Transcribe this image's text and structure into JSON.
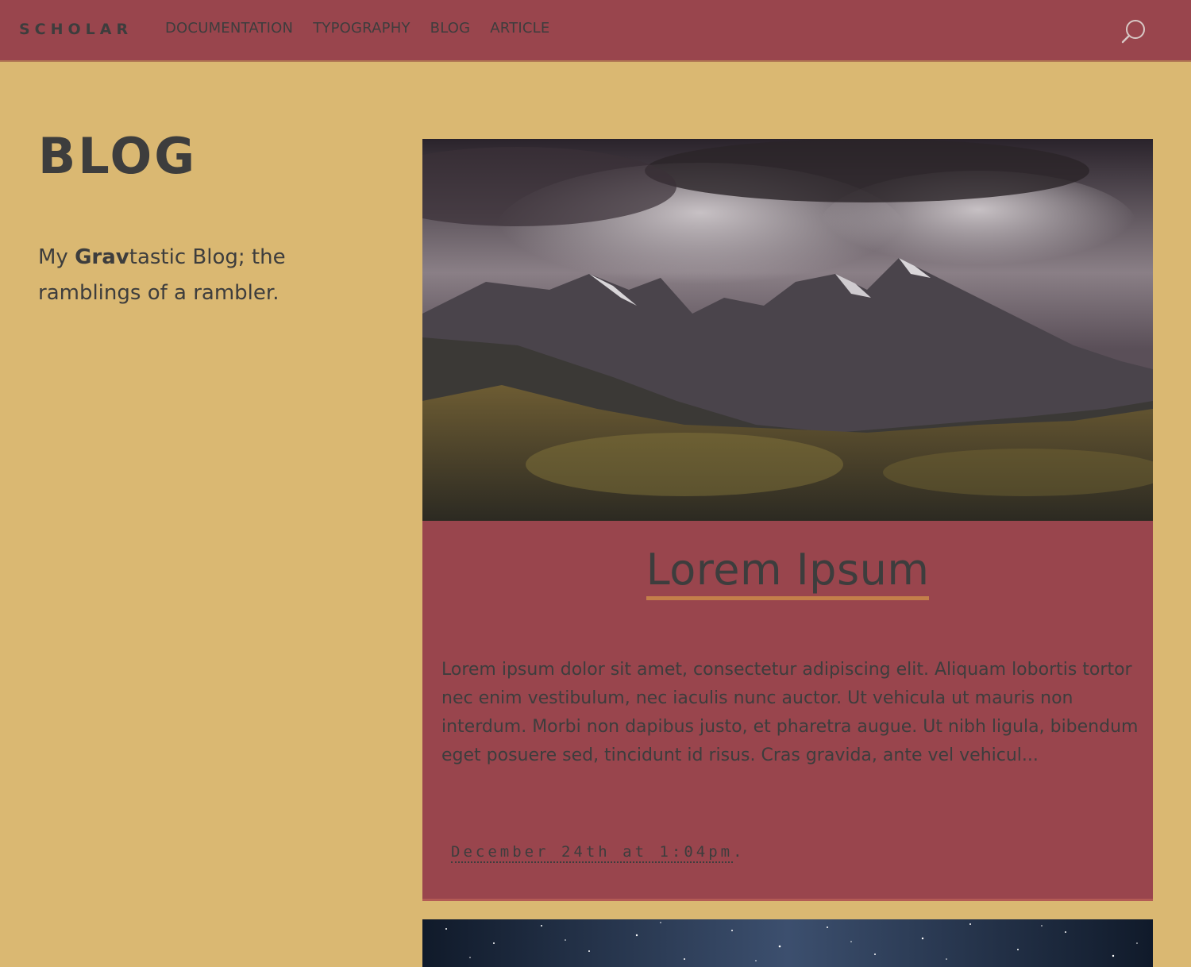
{
  "header": {
    "brand": "SCHOLAR",
    "nav": [
      "DOCUMENTATION",
      "TYPOGRAPHY",
      "BLOG",
      "ARTICLE"
    ],
    "search_icon": "search-icon"
  },
  "sidebar": {
    "title": "BLOG",
    "lead_prefix": "My ",
    "lead_bold": "Grav",
    "lead_suffix": "tastic Blog; the ramblings of a rambler."
  },
  "posts": [
    {
      "title": "Lorem Ipsum",
      "summary": "Lorem ipsum dolor sit amet, consectetur adipiscing elit. Aliquam lobortis tortor nec enim vestibulum, nec iaculis nunc auctor. Ut vehicula ut mauris non interdum. Morbi non dapibus justo, et pharetra augue. Ut nibh ligula, bibendum eget posuere sed, tincidunt id risus. Cras gravida, ante vel vehicul...",
      "date": "December 24th at 1:04pm",
      "image": "mountain-landscape-image"
    }
  ],
  "colors": {
    "background": "#dab872",
    "surface": "#99454d",
    "text": "#3d3d3d",
    "accent": "#c47f4a"
  }
}
